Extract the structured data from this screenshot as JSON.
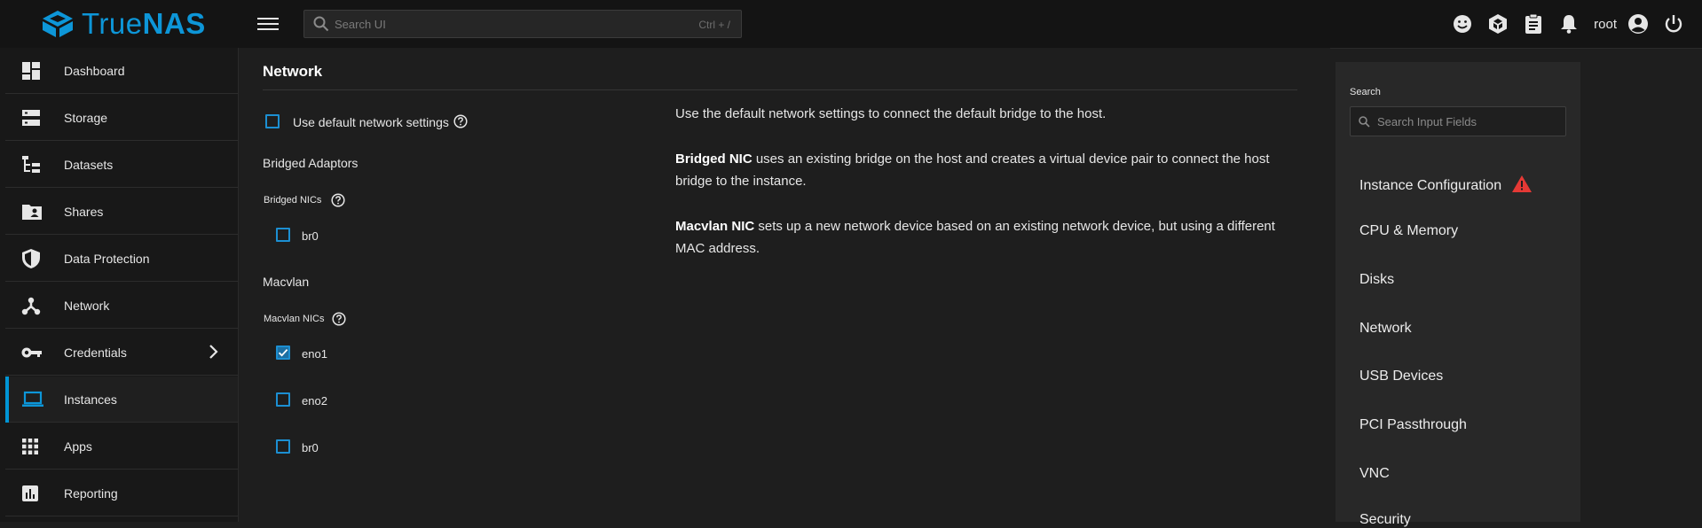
{
  "header": {
    "logo_true": "True",
    "logo_nas": "NAS",
    "search_placeholder": "Search UI",
    "search_shortcut": "Ctrl + /",
    "username": "root"
  },
  "sidebar": {
    "items": [
      {
        "label": "Dashboard",
        "icon": "dashboard-icon"
      },
      {
        "label": "Storage",
        "icon": "storage-icon"
      },
      {
        "label": "Datasets",
        "icon": "datasets-icon"
      },
      {
        "label": "Shares",
        "icon": "shares-icon"
      },
      {
        "label": "Data Protection",
        "icon": "shield-icon"
      },
      {
        "label": "Network",
        "icon": "network-icon"
      },
      {
        "label": "Credentials",
        "icon": "key-icon"
      },
      {
        "label": "Instances",
        "icon": "laptop-icon"
      },
      {
        "label": "Apps",
        "icon": "apps-grid-icon"
      },
      {
        "label": "Reporting",
        "icon": "reporting-icon"
      }
    ],
    "active": "Instances"
  },
  "main": {
    "title": "Network",
    "default_settings_label": "Use default network settings",
    "default_settings_checked": false,
    "bridged_adaptors_heading": "Bridged Adaptors",
    "bridged_nics_label": "Bridged NICs",
    "bridged_nics": [
      {
        "name": "br0",
        "checked": false
      }
    ],
    "macvlan_heading": "Macvlan",
    "macvlan_nics_label": "Macvlan NICs",
    "macvlan_nics": [
      {
        "name": "eno1",
        "checked": true
      },
      {
        "name": "eno2",
        "checked": false
      },
      {
        "name": "br0",
        "checked": false
      }
    ],
    "description": {
      "p1": "Use the default network settings to connect the default bridge to the host.",
      "p2_bold": "Bridged NIC",
      "p2_rest": " uses an existing bridge on the host and creates a virtual device pair to connect the host bridge to the instance.",
      "p3_bold": "Macvlan NIC",
      "p3_rest": " sets up a new network device based on an existing network device, but using a different MAC address."
    }
  },
  "right_panel": {
    "search_label": "Search",
    "search_placeholder": "Search Input Fields",
    "sections": [
      "Instance Configuration",
      "CPU & Memory",
      "Disks",
      "Network",
      "USB Devices",
      "PCI Passthrough",
      "VNC",
      "Security"
    ],
    "warning_section": "Instance Configuration"
  },
  "colors": {
    "accent": "#0095d5",
    "warning": "#e53935"
  }
}
